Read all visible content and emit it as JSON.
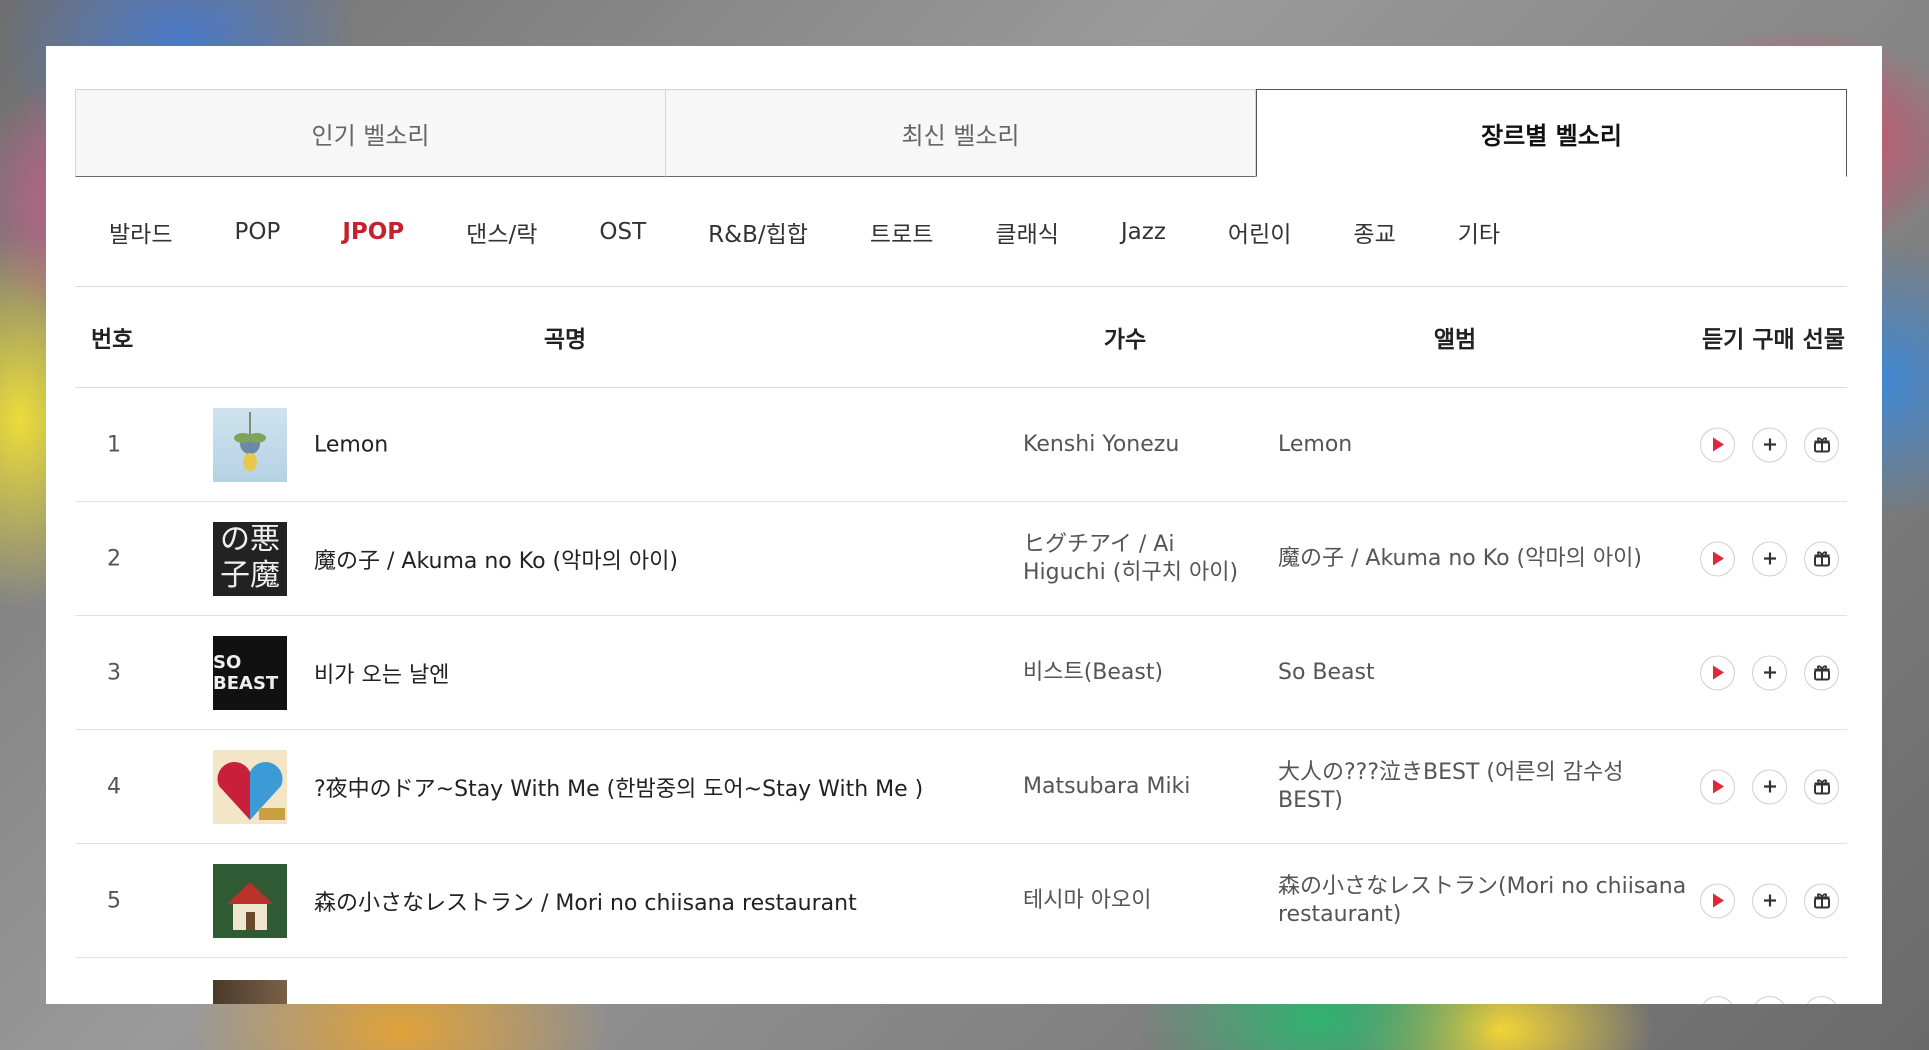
{
  "tabs": [
    {
      "label": "인기 벨소리",
      "active": false
    },
    {
      "label": "최신 벨소리",
      "active": false
    },
    {
      "label": "장르별 벨소리",
      "active": true
    }
  ],
  "genres": [
    {
      "label": "발라드"
    },
    {
      "label": "POP"
    },
    {
      "label": "JPOP",
      "active": true
    },
    {
      "label": "댄스/락"
    },
    {
      "label": "OST"
    },
    {
      "label": "R&B/힙합"
    },
    {
      "label": "트로트"
    },
    {
      "label": "클래식"
    },
    {
      "label": "Jazz"
    },
    {
      "label": "어린이"
    },
    {
      "label": "종교"
    },
    {
      "label": "기타"
    }
  ],
  "table": {
    "headers": {
      "no": "번호",
      "title": "곡명",
      "artist": "가수",
      "album": "앨범",
      "actions": "듣기 구매 선물"
    },
    "rows": [
      {
        "no": "1",
        "title": "Lemon",
        "artist": "Kenshi Yonezu",
        "album": "Lemon",
        "cover": "lemon"
      },
      {
        "no": "2",
        "title": "魔の子 / Akuma no Ko (악마의 아이)",
        "artist": "ヒグチアイ / Ai Higuchi (히구치 아이)",
        "album": "魔の子 / Akuma no Ko (악마의 아이)",
        "cover": "akuma",
        "cover_text": "の悪子魔"
      },
      {
        "no": "3",
        "title": "비가 오는 날엔",
        "artist": "비스트(Beast)",
        "album": "So Beast",
        "cover": "beast",
        "cover_text": "SO BEAST"
      },
      {
        "no": "4",
        "title": "?夜中のドア~Stay With Me (한밤중의 도어~Stay With Me )",
        "artist": "Matsubara Miki",
        "album": "大人の???泣きBEST (어른의 감수성 BEST)",
        "cover": "otona"
      },
      {
        "no": "5",
        "title": "森の小さなレストラン / Mori no chiisana restaurant",
        "artist": "테시마 아오이",
        "album": "森の小さなレストラン(Mori no chiisana restaurant)",
        "cover": "mori"
      }
    ]
  },
  "actions": {
    "play_icon": "play-icon",
    "add_icon": "plus-icon",
    "gift_icon": "gift-icon"
  },
  "colors": {
    "accent_red": "#c8202e",
    "play_red": "#e0283a"
  }
}
